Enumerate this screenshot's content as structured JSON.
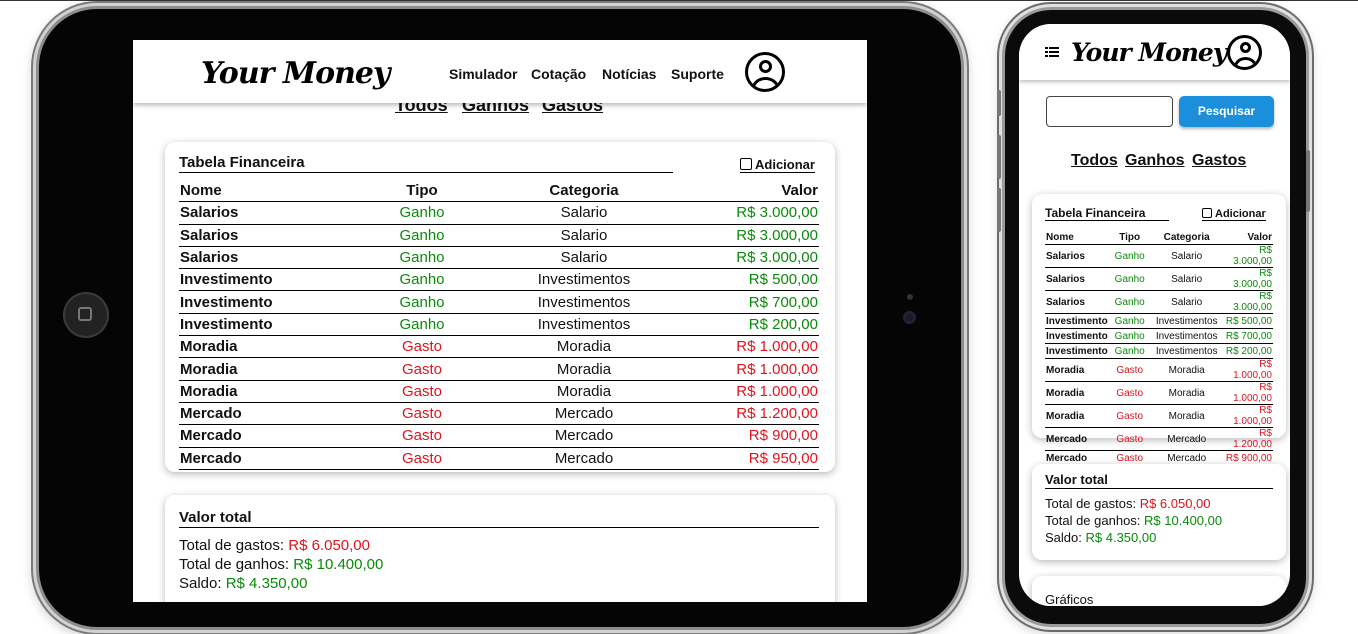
{
  "brand": {
    "name": "Your Money"
  },
  "nav": [
    {
      "label": "Simulador"
    },
    {
      "label": "Cotação"
    },
    {
      "label": "Notícias"
    },
    {
      "label": "Suporte"
    }
  ],
  "filters": [
    {
      "label": "Todos"
    },
    {
      "label": "Ganhos"
    },
    {
      "label": "Gastos"
    }
  ],
  "search": {
    "placeholder": "",
    "button_label": "Pesquisar"
  },
  "table": {
    "title": "Tabela Financeira",
    "add_label": "Adicionar",
    "headers": [
      "Nome",
      "Tipo",
      "Categoria",
      "Valor"
    ],
    "rows": [
      {
        "nome": "Salarios",
        "tipo": "Ganho",
        "categoria": "Salario",
        "valor": "R$ 3.000,00"
      },
      {
        "nome": "Salarios",
        "tipo": "Ganho",
        "categoria": "Salario",
        "valor": "R$ 3.000,00"
      },
      {
        "nome": "Salarios",
        "tipo": "Ganho",
        "categoria": "Salario",
        "valor": "R$ 3.000,00"
      },
      {
        "nome": "Investimento",
        "tipo": "Ganho",
        "categoria": "Investimentos",
        "valor": "R$ 500,00"
      },
      {
        "nome": "Investimento",
        "tipo": "Ganho",
        "categoria": "Investimentos",
        "valor": "R$ 700,00"
      },
      {
        "nome": "Investimento",
        "tipo": "Ganho",
        "categoria": "Investimentos",
        "valor": "R$ 200,00"
      },
      {
        "nome": "Moradia",
        "tipo": "Gasto",
        "categoria": "Moradia",
        "valor": "R$ 1.000,00"
      },
      {
        "nome": "Moradia",
        "tipo": "Gasto",
        "categoria": "Moradia",
        "valor": "R$ 1.000,00"
      },
      {
        "nome": "Moradia",
        "tipo": "Gasto",
        "categoria": "Moradia",
        "valor": "R$ 1.000,00"
      },
      {
        "nome": "Mercado",
        "tipo": "Gasto",
        "categoria": "Mercado",
        "valor": "R$ 1.200,00"
      },
      {
        "nome": "Mercado",
        "tipo": "Gasto",
        "categoria": "Mercado",
        "valor": "R$ 900,00"
      },
      {
        "nome": "Mercado",
        "tipo": "Gasto",
        "categoria": "Mercado",
        "valor": "R$ 950,00"
      }
    ]
  },
  "summary": {
    "title": "Valor total",
    "gastos_label": "Total de gastos:",
    "gastos_value": "R$ 6.050,00",
    "ganhos_label": "Total de ganhos:",
    "ganhos_value": "R$ 10.400,00",
    "saldo_label": "Saldo:",
    "saldo_value": "R$ 4.350,00"
  },
  "charts_section": {
    "title": "Gráficos"
  },
  "colors": {
    "ganho": "#0a8a0a",
    "gasto": "#e0141e",
    "primary_button": "#1c8fdc"
  },
  "icons": {
    "menu": "menu-icon",
    "user": "user-icon",
    "add": "add-icon"
  }
}
